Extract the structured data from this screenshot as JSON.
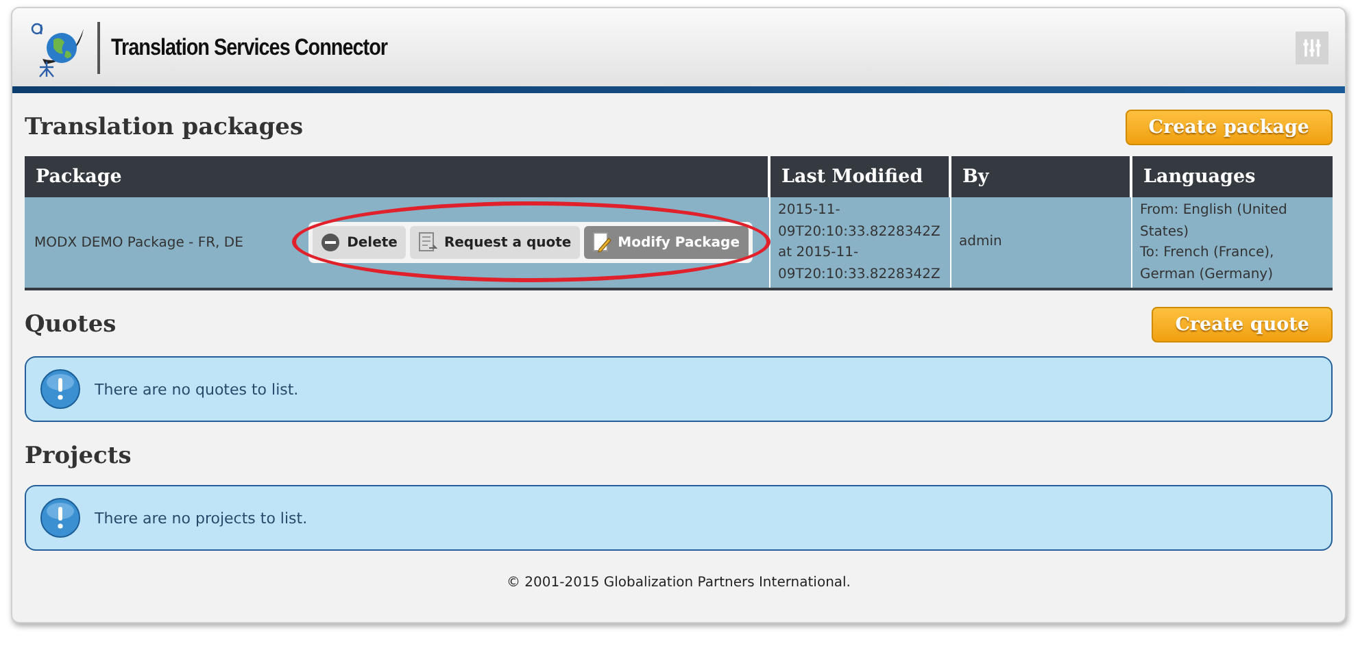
{
  "header": {
    "title": "Translation Services Connector"
  },
  "packages": {
    "title": "Translation packages",
    "create_button": "Create package",
    "columns": [
      "Package",
      "Last Modified",
      "By",
      "Languages"
    ],
    "rows": [
      {
        "name": "MODX  DEMO Package - FR, DE",
        "actions": [
          {
            "kind": "delete",
            "label": "Delete",
            "active": false
          },
          {
            "kind": "quote",
            "label": "Request a quote",
            "active": false
          },
          {
            "kind": "modify",
            "label": "Modify Package",
            "active": true
          }
        ],
        "modified": [
          "2015-11-",
          "09T20:10:33.8228342Z",
          "at 2015-11-",
          "09T20:10:33.8228342Z"
        ],
        "by": "admin",
        "languages": [
          "From: English (United",
          "States)",
          "To: French (France),",
          "German (Germany)"
        ]
      }
    ]
  },
  "quotes": {
    "title": "Quotes",
    "create_button": "Create quote",
    "message": "There are no quotes to list."
  },
  "projects": {
    "title": "Projects",
    "message": "There are no projects to list."
  },
  "footer": "© 2001-2015 Globalization Partners International."
}
